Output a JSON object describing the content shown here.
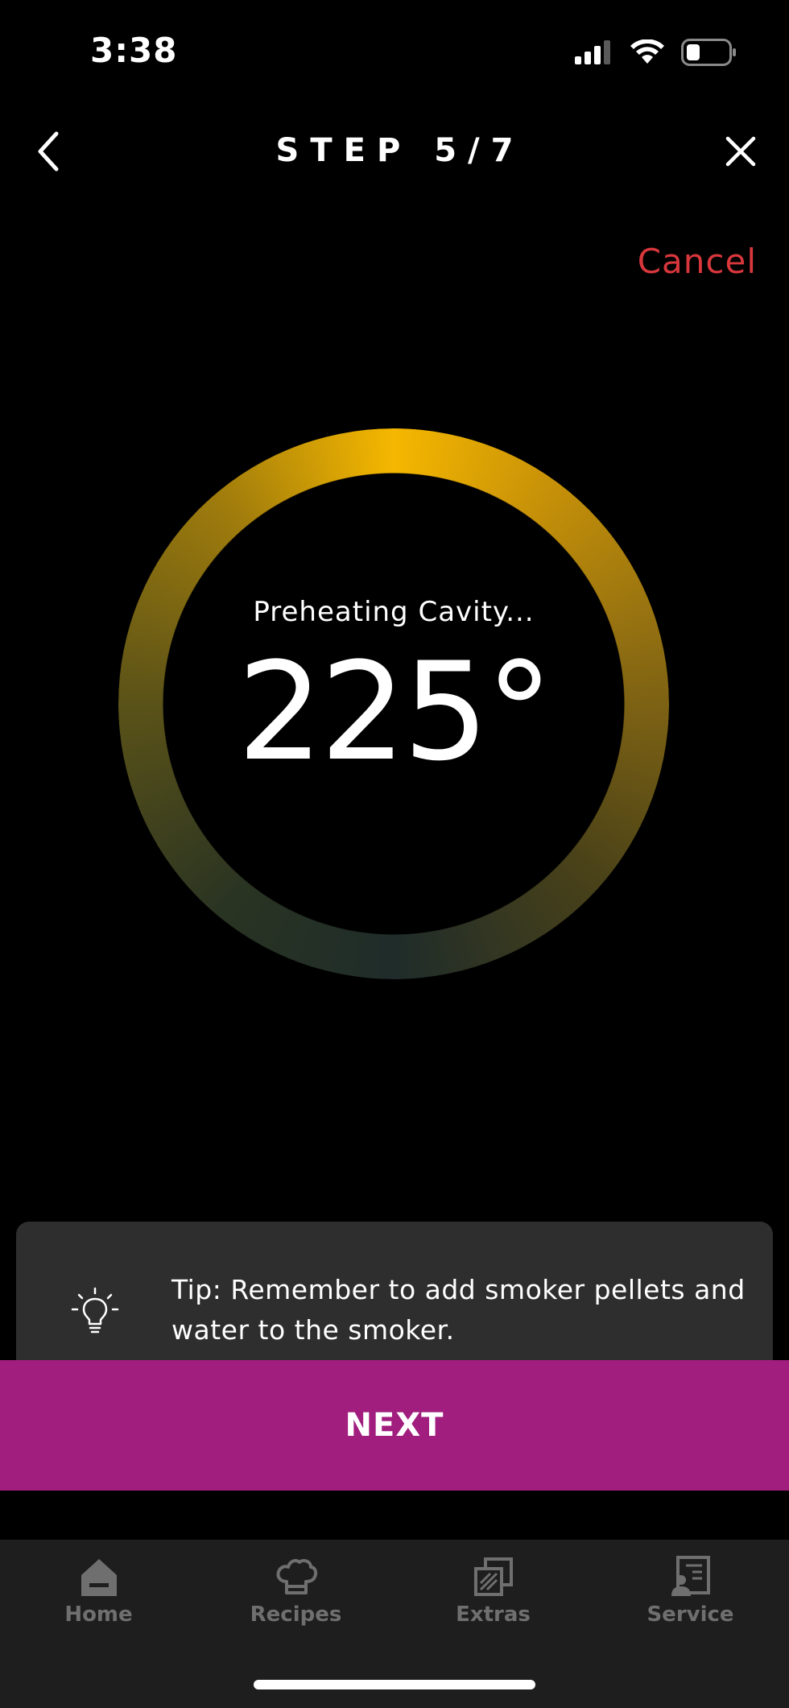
{
  "status_bar": {
    "time": "3:38",
    "icons": [
      "signal-icon",
      "wifi-icon",
      "battery-icon"
    ]
  },
  "header": {
    "title": "STEP 5/7",
    "back_icon": "chevron-left-icon",
    "close_icon": "close-icon"
  },
  "cancel_label": "Cancel",
  "gauge": {
    "label": "Preheating Cavity...",
    "value": "225°"
  },
  "tip": {
    "icon": "lightbulb-icon",
    "text": "Tip: Remember to add smoker pellets and water to the smoker."
  },
  "next_label": "NEXT",
  "tabs": [
    {
      "label": "Home",
      "icon": "home-icon"
    },
    {
      "label": "Recipes",
      "icon": "chef-hat-icon"
    },
    {
      "label": "Extras",
      "icon": "extras-icon"
    },
    {
      "label": "Service",
      "icon": "service-icon"
    }
  ],
  "colors": {
    "background": "#000000",
    "cancel": "#d8373c",
    "next_button": "#a11d7e",
    "tip_card": "#2e2e2e",
    "tab_bar": "#1e1e1e",
    "tab_label": "#6f6f6f",
    "gauge_start": "#f5b700",
    "gauge_end": "#1f2c2a"
  }
}
